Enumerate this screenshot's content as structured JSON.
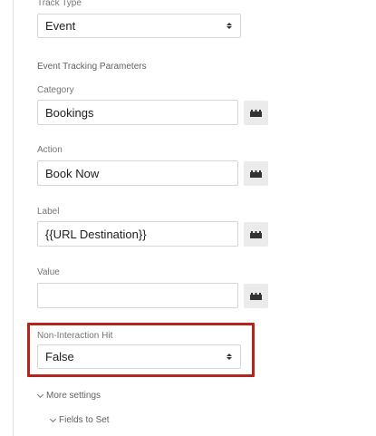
{
  "track_type": {
    "label": "Track Type",
    "value": "Event"
  },
  "section_title": "Event Tracking Parameters",
  "category": {
    "label": "Category",
    "value": "Bookings"
  },
  "action": {
    "label": "Action",
    "value": "Book Now"
  },
  "label_field": {
    "label": "Label",
    "value": "{{URL Destination}}"
  },
  "value_field": {
    "label": "Value",
    "value": ""
  },
  "non_interaction": {
    "label": "Non-Interaction Hit",
    "value": "False",
    "highlight_color": "#b3261e"
  },
  "more_settings": {
    "label": "More settings"
  },
  "fields_to_set": {
    "label": "Fields to Set"
  },
  "icons": {
    "variable_picker": "variable-block-icon",
    "select_arrows": "up-down-arrows-icon",
    "expand": "chevron-down-icon"
  }
}
